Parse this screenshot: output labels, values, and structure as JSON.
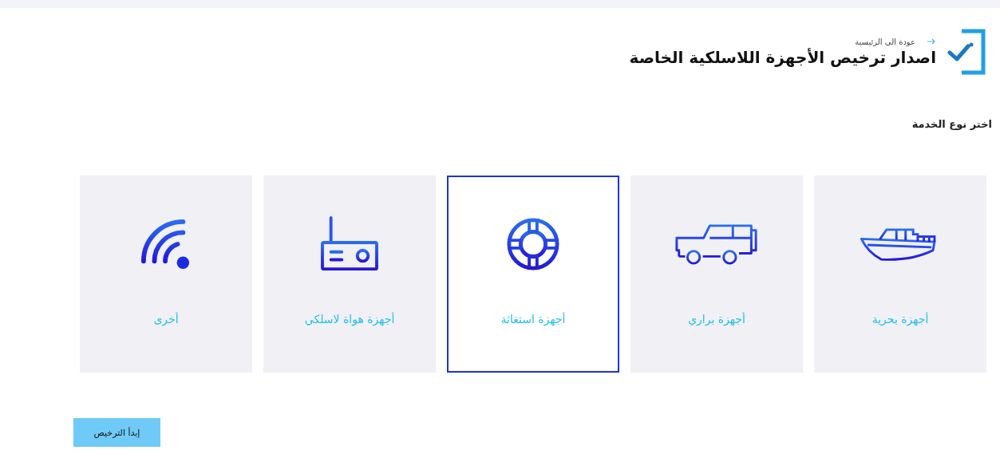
{
  "header": {
    "back_link": "عودة الى الرئيسية",
    "title": "اصدار ترخيص الأجهزة اللاسلكية الخاصة"
  },
  "section_label": "اختر نوع الخدمة",
  "service_cards": [
    {
      "kind": "boat",
      "label": "أجهزة بحرية",
      "selected": false
    },
    {
      "kind": "jeep",
      "label": "أجهزة براري",
      "selected": false
    },
    {
      "kind": "lifebuoy",
      "label": "أجهزة استغاثة",
      "selected": true
    },
    {
      "kind": "radio",
      "label": "أجهزة هواة لاسلكي",
      "selected": false
    },
    {
      "kind": "signal",
      "label": "أخرى",
      "selected": false
    }
  ],
  "start_button": "إبدأ الترخيص"
}
